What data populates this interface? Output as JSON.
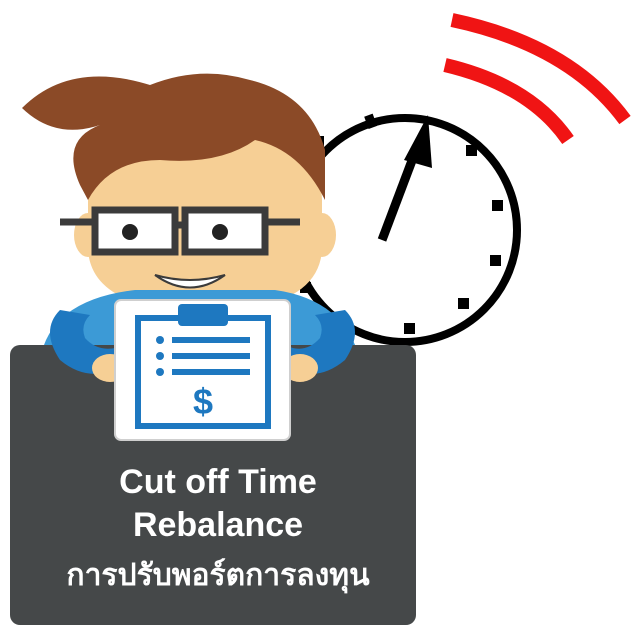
{
  "caption": {
    "line1": "Cut off Time",
    "line2": "Rebalance",
    "line3": "การปรับพอร์ตการลงทุน"
  },
  "icons": {
    "clock": "clock-icon",
    "alarm": "alarm-signal-icon",
    "person": "person-icon",
    "clipboard": "clipboard-icon",
    "dollar": "dollar-icon"
  },
  "colors": {
    "panel": "#454849",
    "alarm": "#f01414",
    "clipboard_blue": "#1e78c0",
    "hair": "#8b4a27",
    "skin": "#f6cf95"
  },
  "dollar_sign": "$"
}
